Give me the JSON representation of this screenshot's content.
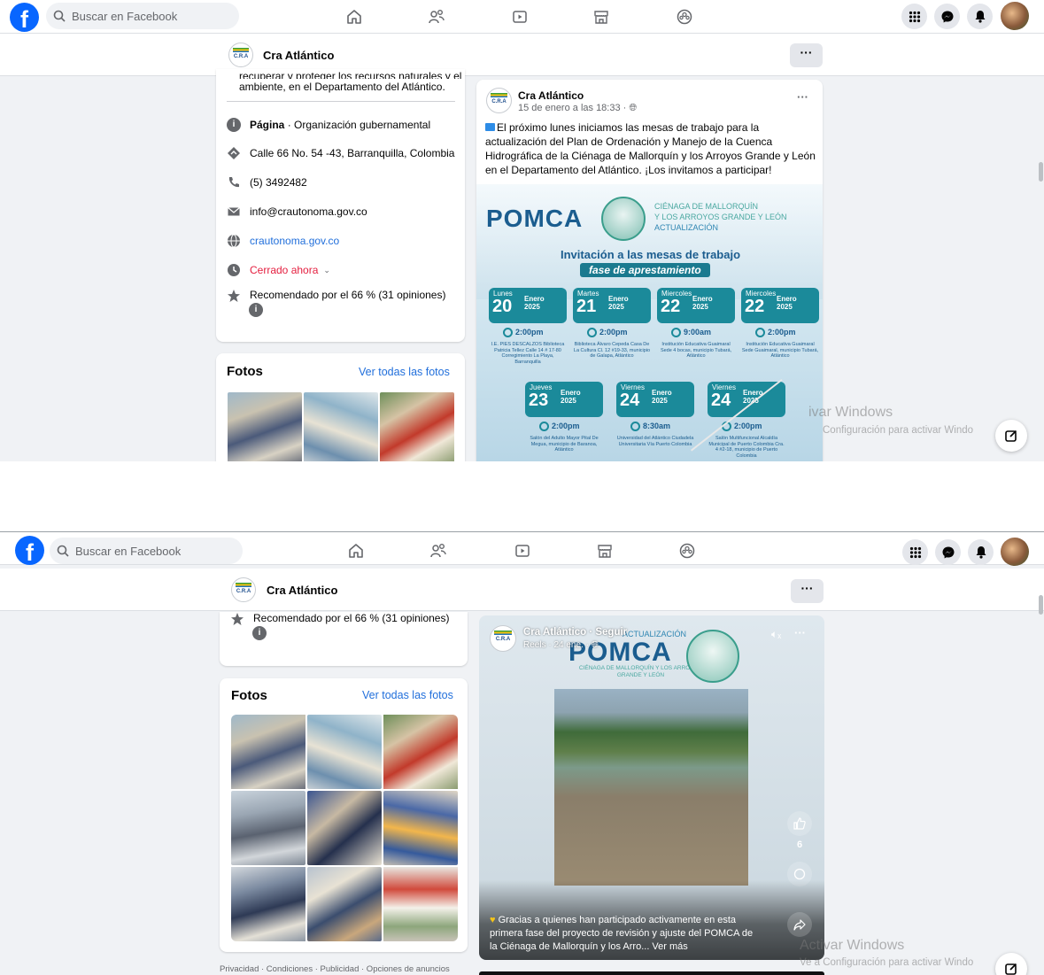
{
  "topbar": {
    "search_placeholder": "Buscar en Facebook"
  },
  "page": {
    "name": "Cra Atlántico",
    "more": "···",
    "logo_text": "C.R.A"
  },
  "about": {
    "cut_text_1": "recuperar y proteger los recursos naturales y el",
    "cut_text_2": "ambiente, en el Departamento del Atlántico.",
    "page_label": "Página",
    "category": " · Organización gubernamental",
    "address": "Calle 66 No. 54 -43, Barranquilla, Colombia",
    "phone": "(5) 3492482",
    "email": "info@crautonoma.gov.co",
    "website": "crautonoma.gov.co",
    "hours": "Cerrado ahora",
    "rating": "Recomendado por el 66 % (31 opiniones)"
  },
  "photos": {
    "title": "Fotos",
    "see_all": "Ver todas las fotos"
  },
  "post": {
    "author": "Cra Atlántico",
    "date": "15 de enero a las 18:33 · ",
    "text": "El próximo lunes iniciamos las mesas de trabajo para la actualización del Plan de Ordenación y Manejo de la Cuenca Hidrográfica de la Ciénaga de Mallorquín y los Arroyos Grande y León en el Departamento del Atlántico. ¡Los invitamos a participar!",
    "flyer": {
      "logo": "POMCA",
      "subtitle_1": "CIÉNAGA DE MALLORQUÍN",
      "subtitle_2": "Y LOS ARROYOS GRANDE Y LEÓN",
      "subtitle_3": "ACTUALIZACIÓN",
      "invite": "Invitación a las mesas de trabajo",
      "phase": "fase de aprestamiento",
      "dates_row1": [
        {
          "wd": "Lunes",
          "day": "20",
          "month": "Enero",
          "year": "2025",
          "time": "2:00pm",
          "venue": "I.E. PIES DESCALZOS Biblioteca Patricia Tellez Calle 14 # 17-80 Corregimiento La Playa, Barranquilla"
        },
        {
          "wd": "Martes",
          "day": "21",
          "month": "Enero",
          "year": "2025",
          "time": "2:00pm",
          "venue": "Biblioteca Álvaro Cepeda Casa De La Cultura Cl. 12 #19-33, municipio de Galapa, Atlántico"
        },
        {
          "wd": "Miercoles",
          "day": "22",
          "month": "Enero",
          "year": "2025",
          "time": "9:00am",
          "venue": "Institución Educativa Guaimaral Sede 4 bocas, municipio Tubará, Atlántico"
        },
        {
          "wd": "Miercoles",
          "day": "22",
          "month": "Enero",
          "year": "2025",
          "time": "2:00pm",
          "venue": "Institución Educativa Guaimaral Sede Guaimaral, municipio Tubará, Atlántico"
        }
      ],
      "dates_row2": [
        {
          "wd": "Jueves",
          "day": "23",
          "month": "Enero",
          "year": "2025",
          "time": "2:00pm",
          "venue": "Salón del Adulto Mayor Pital De Megua, municipio de Baranoa, Atlántico"
        },
        {
          "wd": "Viernes",
          "day": "24",
          "month": "Enero",
          "year": "2025",
          "time": "8:30am",
          "venue": "Universidad del Atlántico Ciudadela Universitaria Vía Puerto Colombia"
        },
        {
          "wd": "Viernes",
          "day": "24",
          "month": "Enero",
          "year": "2025",
          "time": "2:00pm",
          "venue": "Salón Multifuncional Alcaldía Municipal de Puerto Colombia Cra. 4 #2-18, municipio de Puerto Colombia"
        }
      ]
    }
  },
  "reel": {
    "author": "Cra Atlántico · Seguir",
    "meta": "Reels · 24 ene. · ",
    "overlay_title": "ACTUALIZACIÓN",
    "overlay_logo": "POMCA",
    "overlay_sub": "CIÉNAGA DE MALLORQUÍN Y LOS ARROYOS GRANDE Y LEÓN",
    "likes": "6",
    "caption": "Gracias a quienes han participado activamente en esta primera fase del proyecto de revisión y ajuste del POMCA de la Ciénaga de Mallorquín y los Arro... Ver más"
  },
  "footer": "Privacidad · Condiciones · Publicidad · Opciones de anuncios",
  "watermark": {
    "title": "Activar Windows",
    "sub": "Ve a Configuración para activar Windows."
  },
  "watermark_crop": {
    "title_1": "ivar Windows",
    "sub_1": "Configuración para activar Windo",
    "title_2": "Activar Windows",
    "sub_2": "Ve a Configuración para activar Windo"
  },
  "colors": {
    "fb_blue": "#0866ff",
    "link": "#216fdb",
    "hours_red": "#e41e3f",
    "flyer_teal": "#1b8a9a"
  }
}
